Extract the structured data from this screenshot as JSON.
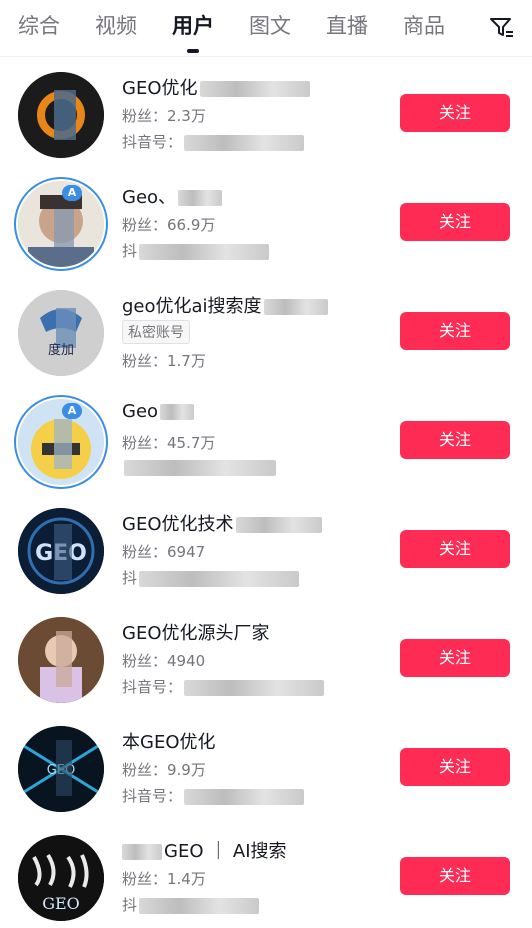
{
  "tabs": [
    {
      "label": "综合",
      "active": false
    },
    {
      "label": "视频",
      "active": false
    },
    {
      "label": "用户",
      "active": true
    },
    {
      "label": "图文",
      "active": false
    },
    {
      "label": "直播",
      "active": false
    },
    {
      "label": "商品",
      "active": false
    }
  ],
  "filter_icon": "filter-icon",
  "accent_color": "#fe2c55",
  "users": [
    {
      "name": "GEO优化",
      "fans": "粉丝：2.3万",
      "line2": "抖音号：",
      "follow": "关注"
    },
    {
      "name": "Geo、",
      "fans": "粉丝：66.9万",
      "line2": "抖",
      "follow": "关注",
      "badge": "A"
    },
    {
      "name": "geo优化ai搜索度",
      "private": "私密账号",
      "fans": "粉丝：1.7万",
      "follow": "关注",
      "avatar_text": "度加"
    },
    {
      "name": "Geo",
      "fans": "粉丝：45.7万",
      "line2": "",
      "follow": "关注",
      "badge": "A"
    },
    {
      "name": "GEO优化技术",
      "fans": "粉丝：6947",
      "line2": "抖",
      "follow": "关注",
      "avatar_text": "GEO"
    },
    {
      "name": "GEO优化源头厂家",
      "fans": "粉丝：4940",
      "line2": "抖音号：",
      "follow": "关注"
    },
    {
      "name": "本GEO优化",
      "fans": "粉丝：9.9万",
      "line2": "抖音号：",
      "follow": "关注",
      "avatar_text": "GEO"
    },
    {
      "name": "GEO ｜ AI搜索",
      "fans": "粉丝：1.4万",
      "line2": "抖",
      "follow": "关注",
      "avatar_text": "GEO"
    }
  ]
}
